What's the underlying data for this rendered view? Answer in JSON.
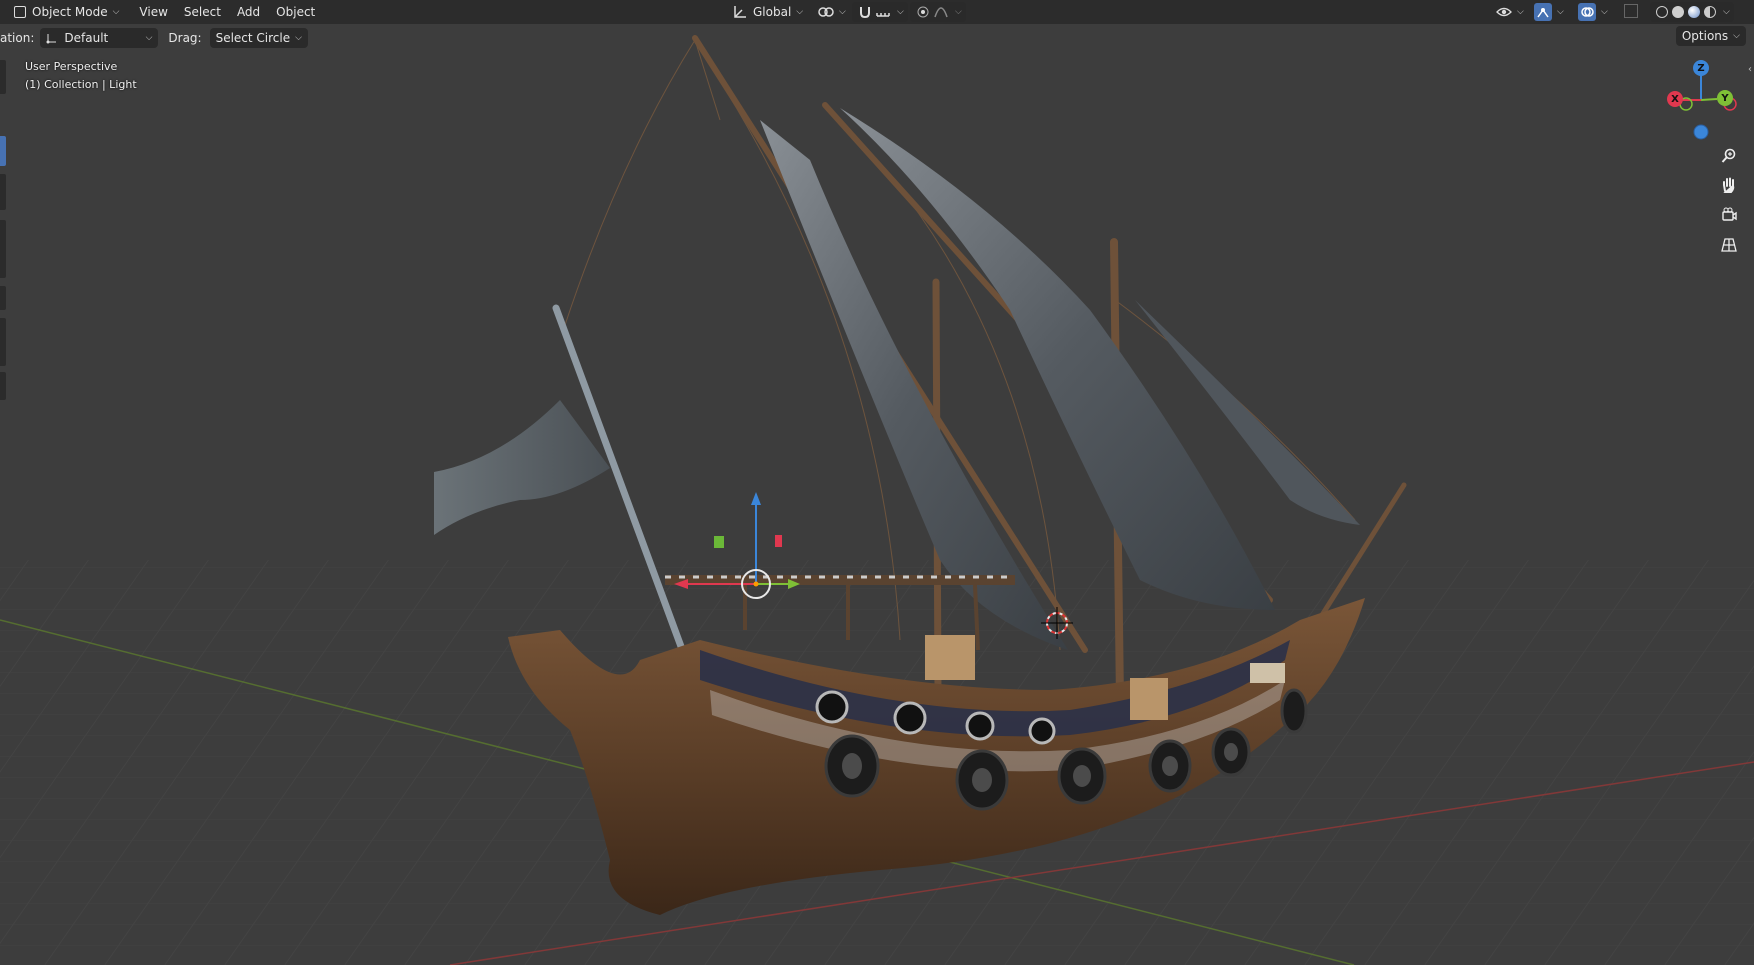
{
  "header": {
    "mode_label": "Object Mode",
    "menus": [
      "View",
      "Select",
      "Add",
      "Object"
    ],
    "transform_orientation": "Global"
  },
  "tool_settings": {
    "orientation_label": "ation:",
    "orientation_value": "Default",
    "drag_label": "Drag:",
    "drag_value": "Select Circle",
    "options_label": "Options"
  },
  "viewport": {
    "perspective": "User Perspective",
    "collection_info": "(1) Collection | Light"
  },
  "gizmo": {
    "z_label": "Z",
    "y_label": "Y",
    "x_label": "X"
  },
  "colors": {
    "x_axis": "#e0384f",
    "y_axis": "#7fc036",
    "z_axis": "#3b86d9",
    "accent": "#4772b3"
  },
  "nav_icons": [
    "zoom-icon",
    "pan-hand-icon",
    "camera-view-icon",
    "ortho-grid-icon"
  ]
}
